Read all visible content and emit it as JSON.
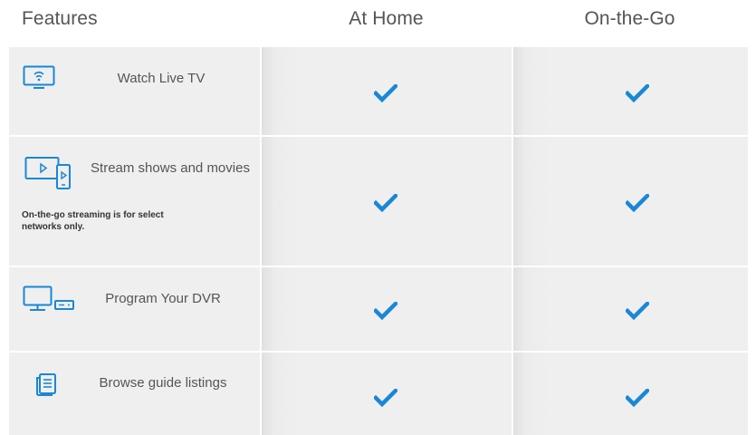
{
  "header": {
    "features": "Features",
    "at_home": "At Home",
    "on_the_go": "On-the-Go"
  },
  "rows": [
    {
      "label": "Watch Live TV",
      "icon": "tv-wifi-icon",
      "at_home": true,
      "on_the_go": true
    },
    {
      "label": "Stream shows and movies",
      "icon": "stream-devices-icon",
      "note": "On-the-go streaming is for select networks only.",
      "at_home": true,
      "on_the_go": true
    },
    {
      "label": "Program Your DVR",
      "icon": "tv-dvr-icon",
      "at_home": true,
      "on_the_go": true
    },
    {
      "label": "Browse guide listings",
      "icon": "guide-listing-icon",
      "at_home": true,
      "on_the_go": true
    }
  ],
  "colors": {
    "accent": "#1a87d6",
    "cell_background": "#efefef",
    "text": "#555555"
  }
}
